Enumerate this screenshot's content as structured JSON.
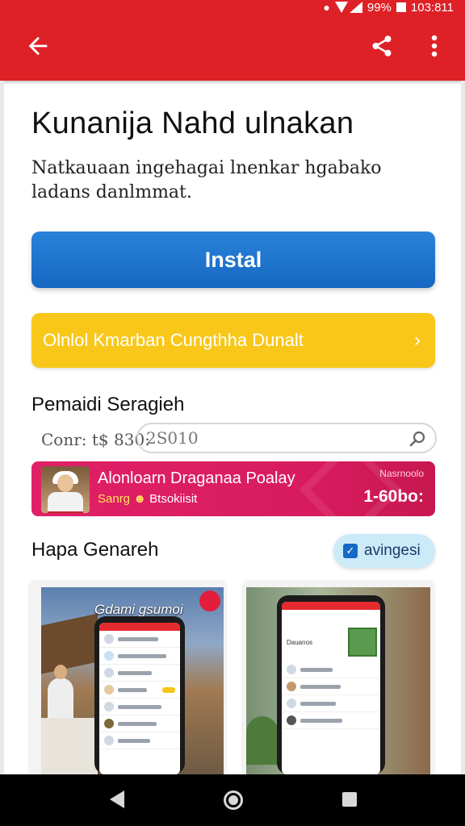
{
  "status_bar": {
    "battery": "99%",
    "time": "103:811"
  },
  "app_bar": {
    "back_icon": "arrow-left-icon",
    "share_icon": "share-icon",
    "more_icon": "more-vertical-icon"
  },
  "header": {
    "title": "Kunanija Nahd ulnakan",
    "description": "Natkauaan ingehagai lnenkar hgabako ladans danlmmat."
  },
  "install_button": {
    "label": "Instal"
  },
  "promo_button": {
    "label": "Olnlol Kmarban Cungthha Dunalt",
    "chevron": "›"
  },
  "pricing": {
    "section_title": "Pemaidi Seragieh",
    "price_label": "Conr: t$ 830:",
    "search_value": "2S010"
  },
  "banner": {
    "title": "Alonloarn Draganaa Poalay",
    "sub_highlight": "Sanrg",
    "sub_rest": "Btsokiisit",
    "tag": "Nasrnoolo",
    "price": "1-60bo:"
  },
  "gallery": {
    "section_title": "Hapa Genareh",
    "chip_label": "avingesi",
    "chip_check": "✓",
    "shot1_caption": "Gdami gsumoi",
    "shot2_header": "Dauanos"
  },
  "colors": {
    "brand_red": "#de2027",
    "install_blue": "#1e74cf",
    "promo_yellow": "#f8c71a",
    "banner_pink": "#dc1c62",
    "chip_blue": "#cdeaf8"
  },
  "nav": {
    "back_icon": "nav-back-icon",
    "home_icon": "nav-home-icon",
    "recent_icon": "nav-recents-icon"
  }
}
